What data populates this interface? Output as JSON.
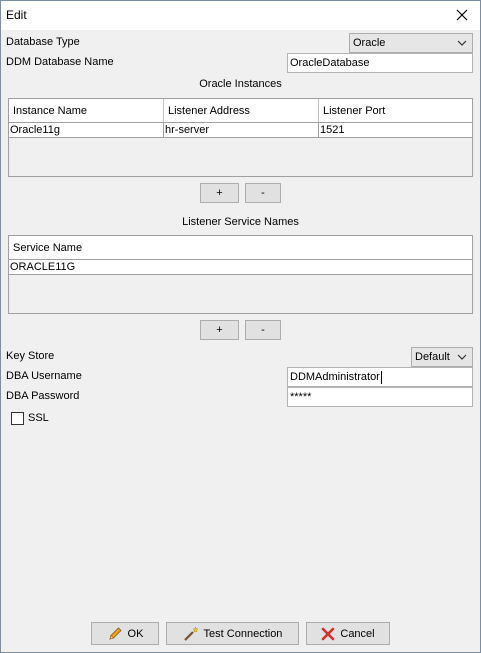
{
  "window": {
    "title": "Edit"
  },
  "database_type": {
    "label": "Database Type",
    "value": "Oracle"
  },
  "ddm_name": {
    "label": "DDM Database Name",
    "value": "OracleDatabase"
  },
  "instances": {
    "section_title": "Oracle Instances",
    "columns": [
      "Instance Name",
      "Listener Address",
      "Listener Port"
    ],
    "rows": [
      [
        "Oracle11g",
        "hr-server",
        "1521"
      ]
    ],
    "add_label": "+",
    "remove_label": "-"
  },
  "services": {
    "section_title": "Listener Service Names",
    "columns": [
      "Service Name"
    ],
    "rows": [
      [
        "ORACLE11G"
      ]
    ],
    "add_label": "+",
    "remove_label": "-"
  },
  "key_store": {
    "label": "Key Store",
    "value": "Default"
  },
  "dba_username": {
    "label": "DBA Username",
    "value": "DDMAdministrator"
  },
  "dba_password": {
    "label": "DBA Password",
    "value": "*****"
  },
  "ssl": {
    "label": "SSL",
    "checked": false
  },
  "buttons": {
    "ok": "OK",
    "test": "Test Connection",
    "cancel": "Cancel"
  },
  "icons": {
    "close": "close-icon",
    "chevron": "chevron-down-icon",
    "ok": "pencil-icon",
    "test": "wand-icon",
    "cancel": "red-x-icon"
  },
  "colors": {
    "cancel_x": "#d0312d",
    "pencil": "#f2a020"
  }
}
